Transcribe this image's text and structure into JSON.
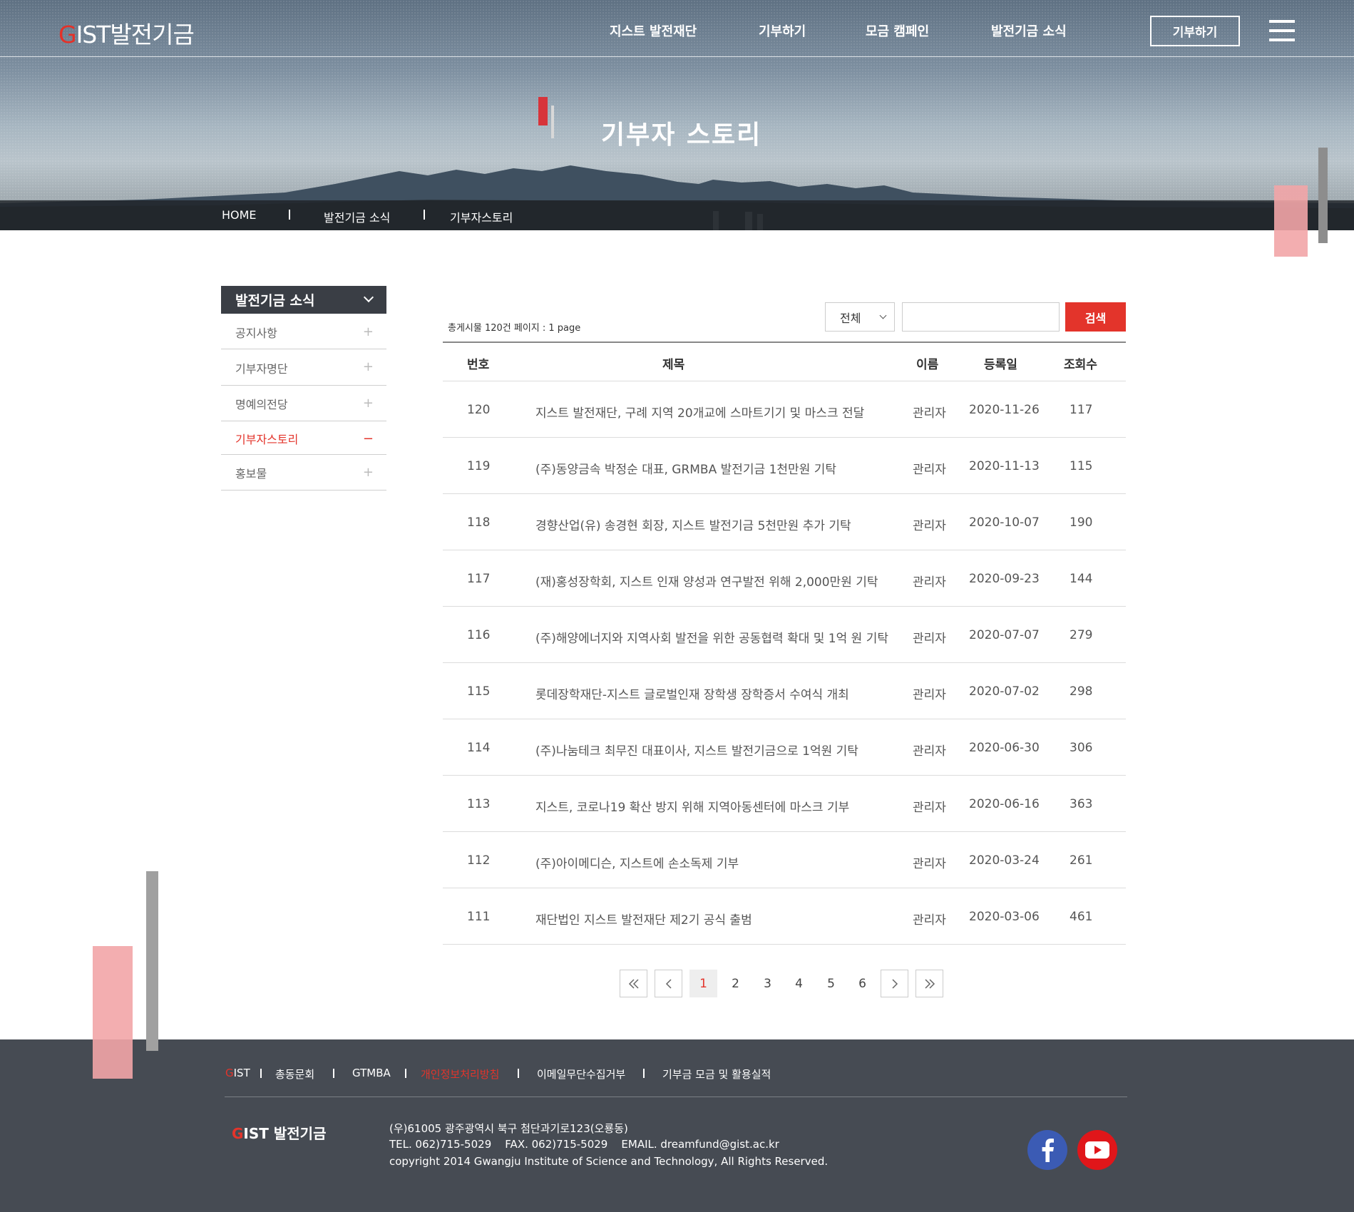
{
  "header": {
    "logo_g": "G",
    "logo_rest": "IST발전기금",
    "nav": [
      "지스트 발전재단",
      "기부하기",
      "모금 캠페인",
      "발전기금 소식"
    ],
    "donate_label": "기부하기"
  },
  "hero": {
    "title": "기부자 스토리",
    "breadcrumb": [
      "HOME",
      "발전기금 소식",
      "기부자스토리"
    ]
  },
  "sidebar": {
    "title": "발전기금 소식",
    "items": [
      {
        "label": "공지사항",
        "mark": "+"
      },
      {
        "label": "기부자명단",
        "mark": "+"
      },
      {
        "label": "명예의전당",
        "mark": "+"
      },
      {
        "label": "기부자스토리",
        "mark": "−"
      },
      {
        "label": "홍보물",
        "mark": "+"
      }
    ]
  },
  "board": {
    "count_text": "총게시물 120건 페이지 : 1 page",
    "filter_value": "전체",
    "search_placeholder": "",
    "search_label": "검색",
    "columns": [
      "번호",
      "제목",
      "이름",
      "등록일",
      "조회수"
    ],
    "rows": [
      {
        "no": "120",
        "title": "지스트 발전재단, 구례 지역 20개교에 스마트기기 및 마스크 전달",
        "name": "관리자",
        "date": "2020-11-26",
        "views": "117"
      },
      {
        "no": "119",
        "title": "(주)동양금속 박정순 대표, GRMBA 발전기금 1천만원 기탁",
        "name": "관리자",
        "date": "2020-11-13",
        "views": "115"
      },
      {
        "no": "118",
        "title": "경향산업(유) 송경현 회장, 지스트 발전기금 5천만원 추가 기탁",
        "name": "관리자",
        "date": "2020-10-07",
        "views": "190"
      },
      {
        "no": "117",
        "title": "(재)홍성장학회, 지스트 인재 양성과 연구발전 위해 2,000만원 기탁",
        "name": "관리자",
        "date": "2020-09-23",
        "views": "144"
      },
      {
        "no": "116",
        "title": "(주)해양에너지와 지역사회 발전을 위한 공동협력 확대 및 1억 원 기탁",
        "name": "관리자",
        "date": "2020-07-07",
        "views": "279"
      },
      {
        "no": "115",
        "title": "롯데장학재단-지스트 글로벌인재 장학생 장학증서 수여식 개최",
        "name": "관리자",
        "date": "2020-07-02",
        "views": "298"
      },
      {
        "no": "114",
        "title": "(주)나눔테크 최무진 대표이사, 지스트 발전기금으로 1억원 기탁",
        "name": "관리자",
        "date": "2020-06-30",
        "views": "306"
      },
      {
        "no": "113",
        "title": "지스트, 코로나19 확산 방지 위해 지역아동센터에 마스크 기부",
        "name": "관리자",
        "date": "2020-06-16",
        "views": "363"
      },
      {
        "no": "112",
        "title": "(주)아이메디슨, 지스트에 손소독제 기부",
        "name": "관리자",
        "date": "2020-03-24",
        "views": "261"
      },
      {
        "no": "111",
        "title": "재단법인 지스트 발전재단 제2기 공식 출범",
        "name": "관리자",
        "date": "2020-03-06",
        "views": "461"
      }
    ]
  },
  "pagination": {
    "pages": [
      "1",
      "2",
      "3",
      "4",
      "5",
      "6"
    ],
    "current": "1"
  },
  "footer": {
    "links": [
      {
        "g": "G",
        "rest": "IST"
      },
      "총동문회",
      "GTMBA",
      "개인정보처리방침",
      "이메일무단수집거부",
      "기부금 모금 및 활용실적"
    ],
    "logo_g": "G",
    "logo_rest": "IST 발전기금",
    "address": "(우)61005 광주광역시 북구 첨단과기로123(오룡동)",
    "contact": "TEL. 062)715-5029    FAX. 062)715-5029    EMAIL. dreamfund@gist.ac.kr",
    "copyright": "copyright 2014 Gwangju Institute of Science and Technology, All Rights Reserved.",
    "icons": [
      "facebook-icon",
      "youtube-icon"
    ]
  },
  "colors": {
    "accent": "#e3342b",
    "footer_bg": "#464b53",
    "sidebar_head_bg": "#3a3e45"
  }
}
